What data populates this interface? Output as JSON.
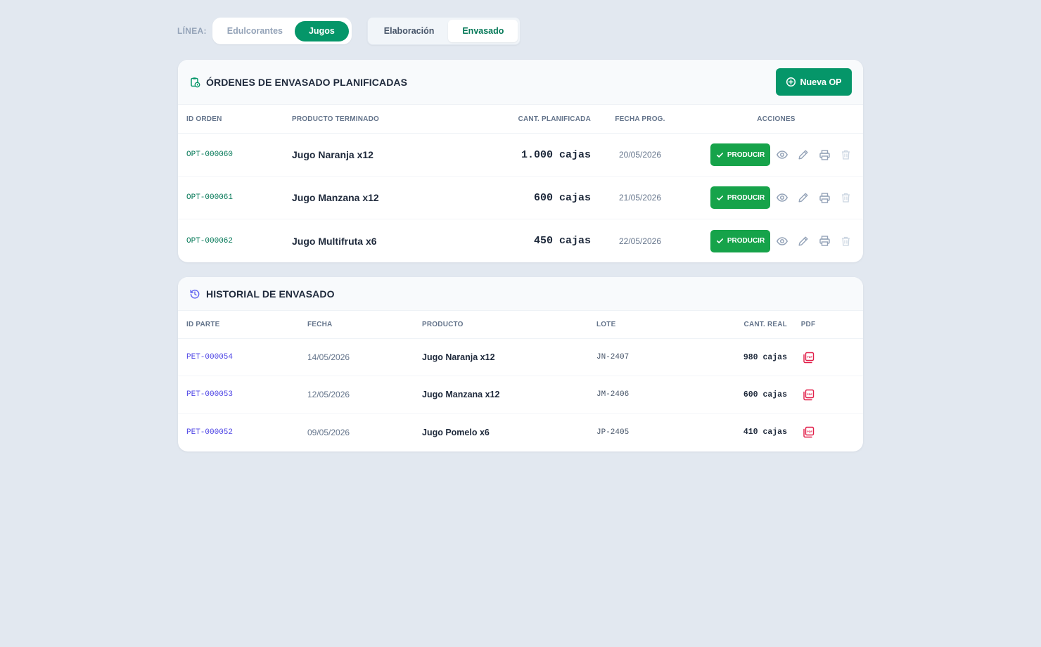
{
  "linea": {
    "label": "LÍNEA:",
    "options": [
      "Edulcorantes",
      "Jugos"
    ],
    "selected": "Jugos"
  },
  "stage": {
    "options": [
      "Elaboración",
      "Envasado"
    ],
    "selected": "Envasado"
  },
  "planned": {
    "title": "ÓRDENES DE ENVASADO PLANIFICADAS",
    "new_button": "Nueva OP",
    "columns": [
      "ID ORDEN",
      "PRODUCTO TERMINADO",
      "CANT. PLANIFICADA",
      "FECHA PROG.",
      "ACCIONES"
    ],
    "produce_label": "PRODUCIR",
    "rows": [
      {
        "id": "OPT-000060",
        "product": "Jugo Naranja x12",
        "qty": "1.000 cajas",
        "date": "20/05/2026"
      },
      {
        "id": "OPT-000061",
        "product": "Jugo Manzana x12",
        "qty": "600 cajas",
        "date": "21/05/2026"
      },
      {
        "id": "OPT-000062",
        "product": "Jugo Multifruta x6",
        "qty": "450 cajas",
        "date": "22/05/2026"
      }
    ]
  },
  "history": {
    "title": "HISTORIAL DE ENVASADO",
    "columns": [
      "ID PARTE",
      "FECHA",
      "PRODUCTO",
      "LOTE",
      "CANT. REAL",
      "PDF"
    ],
    "rows": [
      {
        "id": "PET-000054",
        "date": "14/05/2026",
        "product": "Jugo Naranja x12",
        "lot": "JN-2407",
        "qty": "980 cajas"
      },
      {
        "id": "PET-000053",
        "date": "12/05/2026",
        "product": "Jugo Manzana x12",
        "lot": "JM-2406",
        "qty": "600 cajas"
      },
      {
        "id": "PET-000052",
        "date": "09/05/2026",
        "product": "Jugo Pomelo x6",
        "lot": "JP-2405",
        "qty": "410 cajas"
      }
    ]
  },
  "colors": {
    "accent_green": "#059669",
    "produce_green": "#16a34a",
    "id_green": "#047857",
    "id_blue": "#4f46e5",
    "pdf_red": "#e11d48",
    "background": "#e2e8f0"
  },
  "icons": {
    "planned_header": "clipboard-clock-icon",
    "history_header": "history-icon",
    "new_button": "plus-circle-icon",
    "produce": "check-icon",
    "actions": [
      "eye-icon",
      "pencil-icon",
      "printer-icon",
      "trash-icon"
    ],
    "pdf": "pdf-file-icon"
  }
}
